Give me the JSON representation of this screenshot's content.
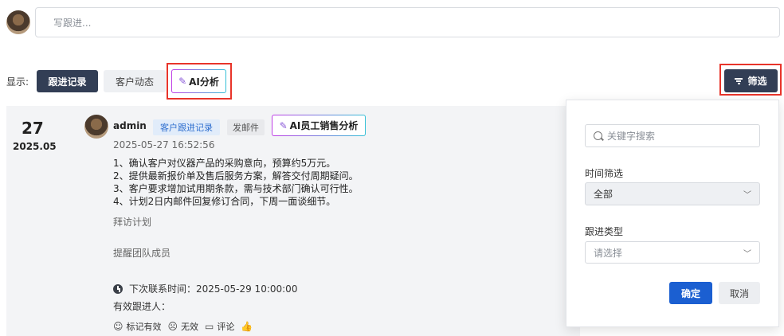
{
  "compose": {
    "placeholder": "写跟进..."
  },
  "display": {
    "label": "显示:",
    "tabs": {
      "records": "跟进记录",
      "dynamics": "客户动态",
      "ai": "AI分析"
    },
    "filter_button": "筛选"
  },
  "record": {
    "day": "27",
    "year_month": "2025.05",
    "user": "admin",
    "type_tag": "客户跟进记录",
    "mail_tag": "发邮件",
    "ai_button": "AI员工销售分析",
    "timestamp": "2025-05-27 16:52:56",
    "content": [
      "1、确认客户对仪器产品的采购意向，预算约5万元。",
      " 2、提供最新报价单及售后服务方案，解答交付周期疑问。",
      " 3、客户要求增加试用期条款，需与技术部门确认可行性。",
      " 4、计划2日内邮件回复修订合同，下周一面谈细节。"
    ],
    "plan": "拜访计划",
    "remind": "提醒团队成员",
    "next_contact": "下次联系时间：2025-05-29 10:00:00",
    "valid_followers": "有效跟进人：",
    "actions": {
      "mark_valid": "标记有效",
      "invalid": "无效",
      "comment": "评论"
    }
  },
  "filter_panel": {
    "search_placeholder": "关键字搜索",
    "time_label": "时间筛选",
    "time_value": "全部",
    "type_label": "跟进类型",
    "type_placeholder": "请选择",
    "confirm": "确定",
    "cancel": "取消"
  }
}
